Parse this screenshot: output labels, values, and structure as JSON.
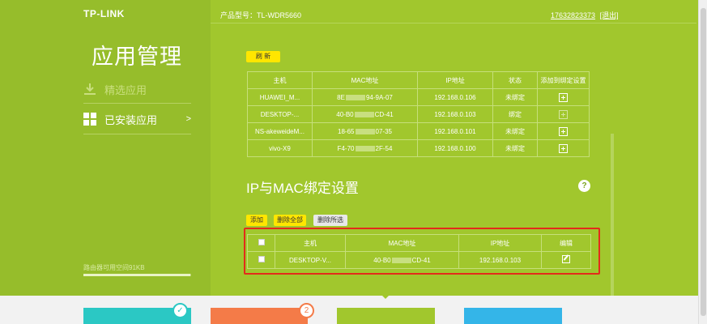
{
  "brand": "TP-LINK",
  "header": {
    "model_label": "产品型号：TL-WDR5660",
    "phone": "17632823373",
    "logout": "[退出]"
  },
  "sidebar": {
    "title": "应用管理",
    "items": [
      {
        "label": "精选应用",
        "icon": "download-icon",
        "active": false
      },
      {
        "label": "已安装应用",
        "icon": "grid-icon",
        "active": true,
        "arrow": ">"
      }
    ],
    "storage_text": "路由器可用空间91KB",
    "storage_fill_fraction": 0.99
  },
  "devices": {
    "refresh_label": "刷 新",
    "columns": [
      "主机",
      "MAC地址",
      "IP地址",
      "状态",
      "添加到绑定设置"
    ],
    "rows": [
      {
        "host": "HUAWEI_M...",
        "mac_prefix": "8E",
        "mac_suffix": "94-9A-07",
        "ip": "192.168.0.106",
        "status": "未绑定"
      },
      {
        "host": "DESKTOP-...",
        "mac_prefix": "40-B0",
        "mac_suffix": "CD-41",
        "ip": "192.168.0.103",
        "status": "绑定"
      },
      {
        "host": "NS-akeweideM...",
        "mac_prefix": "18-65",
        "mac_suffix": "07-35",
        "ip": "192.168.0.101",
        "status": "未绑定"
      },
      {
        "host": "vivo-X9",
        "mac_prefix": "F4-70",
        "mac_suffix": "2F-54",
        "ip": "192.168.0.100",
        "status": "未绑定"
      }
    ]
  },
  "binding": {
    "title": "IP与MAC绑定设置",
    "help": "?",
    "add_label": "添加",
    "delete_all_label": "删除全部",
    "delete_selected_label": "删除所选",
    "columns": [
      "主机",
      "MAC地址",
      "IP地址",
      "编辑"
    ],
    "rows": [
      {
        "host": "DESKTOP-V...",
        "mac_prefix": "40-B0",
        "mac_suffix": "CD-41",
        "ip": "192.168.0.103"
      }
    ]
  },
  "bottom_tiles": [
    {
      "color": "#2bc8c4",
      "badge": "✓"
    },
    {
      "color": "#f47b48",
      "badge": "2"
    },
    {
      "color": "#a1c72d"
    },
    {
      "color": "#34b5e8"
    }
  ]
}
